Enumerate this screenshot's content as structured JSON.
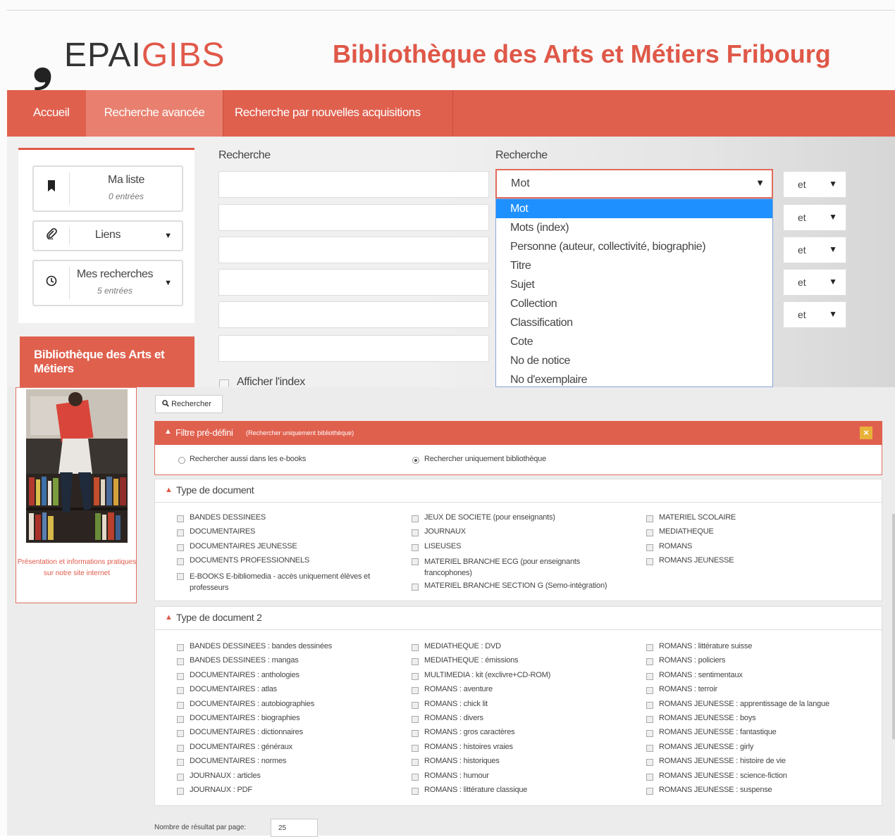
{
  "header": {
    "logo_left": "EPAI",
    "logo_right": "GIBS",
    "site_title": "Bibliothèque des Arts et Métiers Fribourg"
  },
  "nav": {
    "items": [
      "Accueil",
      "Recherche avancée",
      "Recherche par nouvelles acquisitions"
    ],
    "active": "Recherche avancée"
  },
  "sidebar": {
    "my_list": {
      "label": "Ma liste",
      "sub": "0 entrées"
    },
    "links": {
      "label": "Liens"
    },
    "my_searches": {
      "label": "Mes recherches",
      "sub": "5 entrées"
    },
    "library_title": "Bibliothèque des Arts et Métiers",
    "caption": "Présentation et informations pratiques sur notre site internet"
  },
  "search": {
    "label_left": "Recherche",
    "label_right": "Recherche",
    "field_select_value": "Mot",
    "show_index_label": "Afficher l'index",
    "operator": "et",
    "dropdown_options": [
      "Mot",
      "Mots (index)",
      "Personne (auteur, collectivité, biographie)",
      "Titre",
      "Sujet",
      "Collection",
      "Classification",
      "Cote",
      "No de notice",
      "No d'exemplaire"
    ],
    "search_button": "Rechercher"
  },
  "filter": {
    "title": "Filtre pré-défini",
    "title_sub": "(Rechercher uniquement bibliothèque)",
    "close_label": "×",
    "option_all": "Rechercher aussi dans les e-books",
    "option_lib": "Rechercher uniquement bibliothèque"
  },
  "doc_type": {
    "title": "Type de document",
    "col1": [
      "BANDES DESSINEES",
      "DOCUMENTAIRES",
      "DOCUMENTAIRES JEUNESSE",
      "DOCUMENTS PROFESSIONNELS",
      "E-BOOKS E-bibliomedia - accès uniquement élèves et professeurs"
    ],
    "col2": [
      "JEUX DE SOCIETE (pour enseignants)",
      "JOURNAUX",
      "LISEUSES",
      "MATERIEL BRANCHE ECG (pour enseignants francophones)",
      "MATERIEL BRANCHE SECTION G (Semo-intégration)"
    ],
    "col3": [
      "MATERIEL SCOLAIRE",
      "MEDIATHEQUE",
      "ROMANS",
      "ROMANS JEUNESSE"
    ]
  },
  "doc_type2": {
    "title": "Type de document 2",
    "col1": [
      "BANDES DESSINEES : bandes dessinées",
      "BANDES DESSINEES : mangas",
      "DOCUMENTAIRES : anthologies",
      "DOCUMENTAIRES : atlas",
      "DOCUMENTAIRES : autobiographies",
      "DOCUMENTAIRES : biographies",
      "DOCUMENTAIRES : dictionnaires",
      "DOCUMENTAIRES : généraux",
      "DOCUMENTAIRES : normes",
      "JOURNAUX : articles",
      "JOURNAUX : PDF"
    ],
    "col2": [
      "MEDIATHEQUE : DVD",
      "MEDIATHEQUE : émissions",
      "MULTIMEDIA : kit (exclivre+CD-ROM)",
      "ROMANS : aventure",
      "ROMANS : chick lit",
      "ROMANS : divers",
      "ROMANS : gros caractères",
      "ROMANS : histoires vraies",
      "ROMANS : historiques",
      "ROMANS : humour",
      "ROMANS : littérature classique"
    ],
    "col3": [
      "ROMANS : littérature suisse",
      "ROMANS : policiers",
      "ROMANS : sentimentaux",
      "ROMANS : terroir",
      "ROMANS JEUNESSE : apprentissage de la langue",
      "ROMANS JEUNESSE : boys",
      "ROMANS JEUNESSE : fantastique",
      "ROMANS JEUNESSE : girly",
      "ROMANS JEUNESSE : histoire de vie",
      "ROMANS JEUNESSE : science-fiction",
      "ROMANS JEUNESSE : suspense"
    ]
  },
  "results_per_page": {
    "label": "Nombre de résultat par page:",
    "value": "25"
  },
  "colors": {
    "brand": "#df5848",
    "nav": "#e0604e",
    "nav_active": "#e9806f",
    "dropdown_selected": "#1e90ff"
  }
}
